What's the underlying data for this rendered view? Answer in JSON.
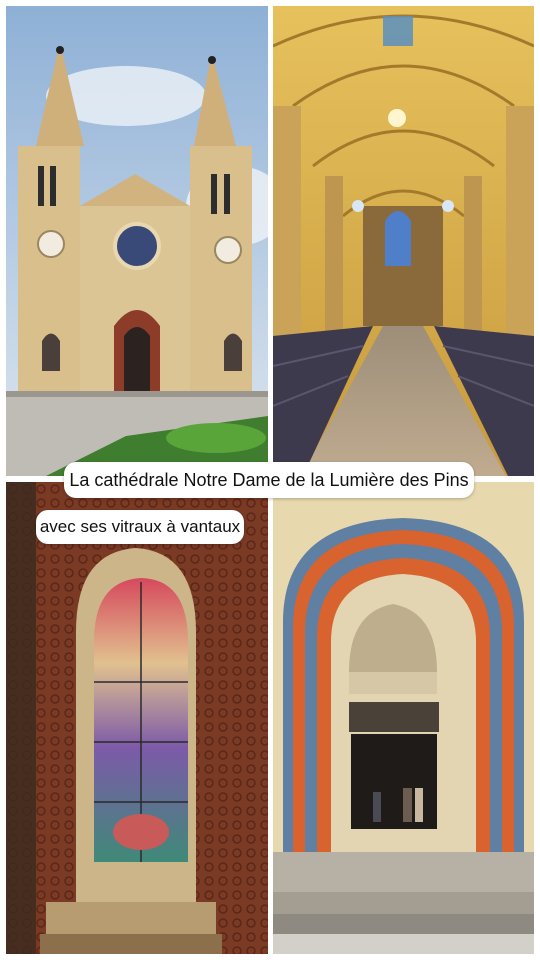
{
  "captions": {
    "main": "La cathédrale Notre Dame de la Lumière des Pins",
    "sub": "avec ses vitraux à vantaux"
  },
  "photos": [
    {
      "name": "cathedral-exterior-photo"
    },
    {
      "name": "cathedral-nave-photo"
    },
    {
      "name": "stained-glass-window-photo"
    },
    {
      "name": "cathedral-portal-photo"
    }
  ],
  "colors": {
    "facade": "#d8bf8c",
    "vault_gold": "#d9b04a",
    "brick": "#7b3a24",
    "arch_orange": "#d8632f",
    "arch_blue": "#5f7fa3"
  }
}
